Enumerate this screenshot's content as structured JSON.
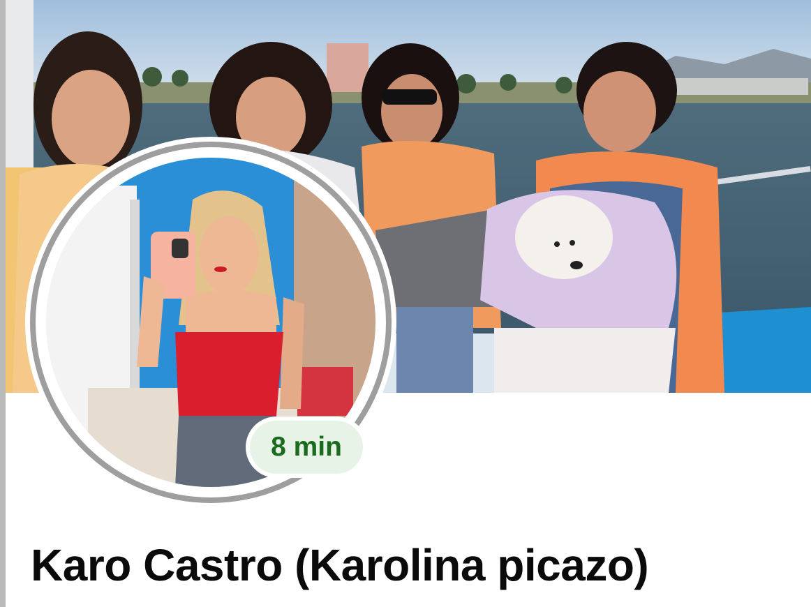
{
  "profile": {
    "name": "Karo Castro (Karolina picazo)",
    "story_badge": "8 min"
  },
  "colors": {
    "badge_background": "#e7f3e6",
    "badge_text": "#1b6b1f",
    "avatar_ring": "#9e9e9e",
    "name_text": "#0a0a0a",
    "background": "#ffffff"
  }
}
